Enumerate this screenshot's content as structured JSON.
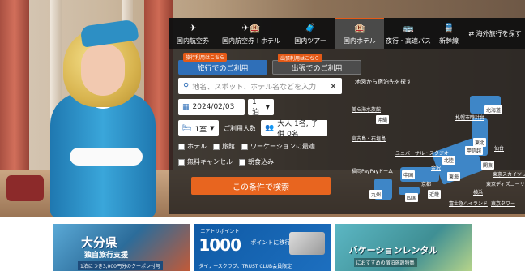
{
  "tabs": [
    {
      "icon": "plane-icon",
      "glyph": "✈",
      "label": "国内航空券"
    },
    {
      "icon": "plane-hotel-icon",
      "glyph": "✈🏨",
      "label": "国内航空券＋ホテル"
    },
    {
      "icon": "suitcase-icon",
      "glyph": "🧳",
      "label": "国内ツアー"
    },
    {
      "icon": "hotel-icon",
      "glyph": "🏨",
      "label": "国内ホテル"
    },
    {
      "icon": "bus-icon",
      "glyph": "🚌",
      "label": "夜行・高速バス"
    },
    {
      "icon": "train-icon",
      "glyph": "🚆",
      "label": "新幹線"
    }
  ],
  "overseas_link": "⇄ 海外旅行を探す",
  "modes": {
    "leisure": {
      "tag": "旅行利用はこちら",
      "label": "旅行でのご利用"
    },
    "business": {
      "tag": "出張利用はこちら",
      "label": "出張でのご利用"
    }
  },
  "search": {
    "placeholder": "地名、スポット、ホテル名などを入力",
    "clear": "✕"
  },
  "date": "2024/02/03",
  "nights": "1泊",
  "rooms": "1室",
  "guests_label": "ご利用人数",
  "guests_value": "大人 1名, 子供 0名",
  "filters": [
    "ホテル",
    "旅館",
    "ワーケーションに最適",
    "無料キャンセル",
    "朝食込み"
  ],
  "submit": "この条件で検索",
  "map": {
    "title": "地図から宿泊先を探す",
    "regions": [
      "北海道",
      "東北",
      "北陸",
      "関東",
      "甲信越",
      "東海",
      "近畿",
      "中国",
      "四国",
      "九州",
      "沖縄"
    ],
    "cities": [
      "美ら海水族館",
      "札幌市時計台",
      "宮古島・石垣島",
      "ユニバーサル・スタジオ",
      "福岡PayPayドーム",
      "仙台",
      "東京スカイツリー",
      "東京ディズニーリゾート",
      "東京タワー",
      "富士急ハイランド",
      "金沢",
      "京都",
      "横浜"
    ]
  },
  "banners": {
    "oita": {
      "title": "大分県",
      "subtitle": "独自旅行支援",
      "note": "1泊につき3,000円分のクーポン付与"
    },
    "points": {
      "top": "エアトリポイント",
      "number": "1000",
      "text": "ポイントに移行できます",
      "bottom": "ダイナースクラブ、TRUST CLUB会員限定"
    },
    "package": {
      "title": "バケーションレンタル",
      "subtitle": "におすすめの宿泊施設特集"
    }
  }
}
